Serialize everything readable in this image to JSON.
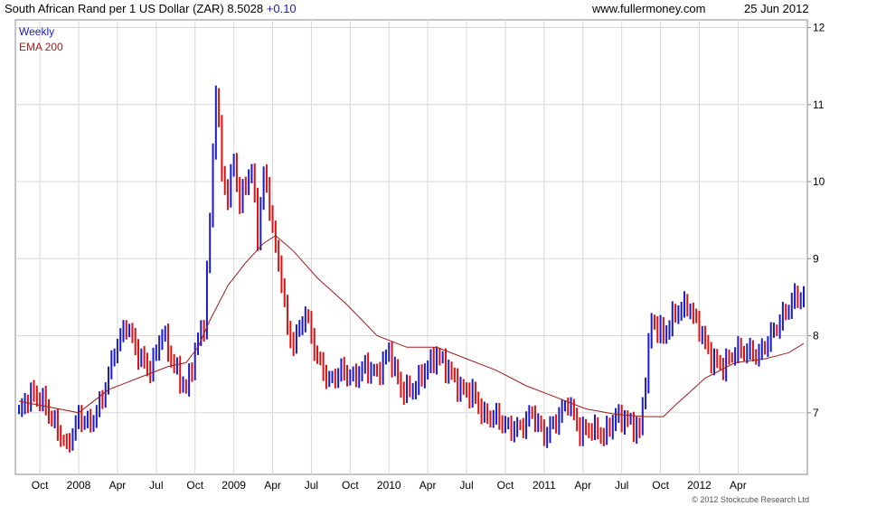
{
  "header": {
    "title": "South African Rand per 1 US Dollar (ZAR) 8.5028",
    "change": "+0.10",
    "site": "www.fullermoney.com",
    "date": "25 Jun 2012"
  },
  "footer": {
    "copyright": "© 2012 Stockcube Research Ltd"
  },
  "colors": {
    "up": "#1a1acc",
    "down": "#dd1111",
    "ema": "#a01c1c",
    "grid": "#d8d8d8"
  },
  "chart_data": {
    "type": "line",
    "title": "South African Rand per 1 US Dollar (ZAR) 8.5028",
    "frequency": "Weekly",
    "ylim": [
      6.2,
      12.1
    ],
    "y_ticks": [
      7,
      8,
      9,
      10,
      11,
      12
    ],
    "x_tick_labels": [
      "Oct",
      "2008",
      "Apr",
      "Jul",
      "Oct",
      "2009",
      "Apr",
      "Jul",
      "Oct",
      "2010",
      "Apr",
      "Jul",
      "Oct",
      "2011",
      "Apr",
      "Jul",
      "Oct",
      "2012",
      "Apr"
    ],
    "x_tick_weeks": [
      7,
      20,
      33,
      46,
      59,
      72,
      85,
      98,
      111,
      124,
      137,
      150,
      163,
      176,
      189,
      202,
      215,
      228,
      241
    ],
    "week_count": 264,
    "legend": [
      "Weekly",
      "EMA 200"
    ],
    "series": [
      {
        "name": "Weekly",
        "style": "high-low bars",
        "x_week": [
          0,
          4,
          8,
          12,
          16,
          20,
          24,
          28,
          32,
          36,
          40,
          44,
          48,
          52,
          56,
          60,
          62,
          64,
          66,
          68,
          70,
          72,
          74,
          76,
          78,
          80,
          82,
          84,
          86,
          88,
          90,
          92,
          96,
          100,
          104,
          108,
          112,
          116,
          120,
          124,
          128,
          132,
          136,
          140,
          144,
          148,
          152,
          156,
          160,
          164,
          168,
          172,
          176,
          180,
          184,
          188,
          192,
          196,
          200,
          204,
          208,
          212,
          216,
          220,
          224,
          228,
          232,
          236,
          240,
          244,
          248,
          252,
          256,
          260,
          263
        ],
        "close": [
          7.0,
          7.25,
          7.15,
          6.85,
          6.55,
          6.95,
          6.85,
          7.2,
          7.8,
          8.15,
          7.75,
          7.55,
          8.05,
          7.6,
          7.3,
          7.95,
          8.15,
          9.5,
          11.25,
          10.1,
          9.8,
          10.3,
          9.7,
          10.0,
          10.15,
          9.3,
          10.1,
          9.7,
          9.1,
          8.75,
          8.05,
          7.9,
          8.3,
          7.7,
          7.4,
          7.55,
          7.45,
          7.6,
          7.5,
          7.8,
          7.3,
          7.3,
          7.55,
          7.75,
          7.55,
          7.3,
          7.25,
          6.95,
          6.95,
          6.8,
          6.8,
          7.0,
          6.7,
          6.9,
          7.15,
          6.75,
          6.8,
          6.7,
          6.95,
          6.9,
          6.75,
          8.2,
          8.0,
          8.3,
          8.4,
          8.1,
          7.7,
          7.6,
          7.8,
          7.8,
          7.75,
          8.0,
          8.25,
          8.5,
          8.5
        ]
      },
      {
        "name": "EMA 200",
        "x_week": [
          0,
          20,
          30,
          40,
          50,
          56,
          60,
          64,
          70,
          76,
          82,
          86,
          92,
          100,
          110,
          120,
          130,
          140,
          150,
          160,
          170,
          180,
          190,
          200,
          210,
          216,
          220,
          230,
          240,
          250,
          258,
          263
        ],
        "values": [
          7.15,
          7.0,
          7.3,
          7.45,
          7.6,
          7.65,
          7.85,
          8.2,
          8.65,
          8.95,
          9.2,
          9.3,
          9.1,
          8.75,
          8.4,
          8.0,
          7.85,
          7.85,
          7.7,
          7.55,
          7.35,
          7.2,
          7.05,
          6.98,
          6.95,
          6.95,
          7.1,
          7.45,
          7.65,
          7.7,
          7.78,
          7.9
        ]
      }
    ]
  }
}
